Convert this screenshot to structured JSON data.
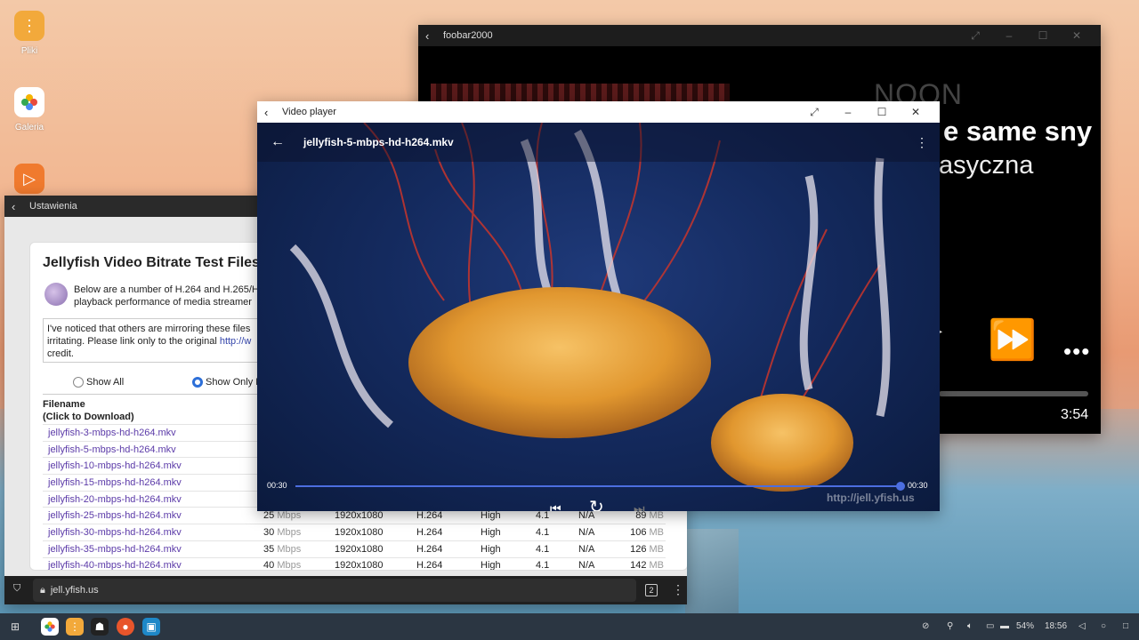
{
  "desktop": {
    "icons": [
      {
        "label": "Pliki",
        "icon": "files-icon",
        "color": "#f2a93b"
      },
      {
        "label": "Galeria",
        "icon": "gallery-icon",
        "color": "#ffffff"
      },
      {
        "label": "",
        "icon": "video-player-icon",
        "color": "#f07a2e"
      }
    ]
  },
  "foobar": {
    "title": "foobar2000",
    "artist_partial": "NOON",
    "song_partial": "e same sny",
    "genre_partial": "asyczna",
    "duration": "3:54"
  },
  "settings": {
    "title": "Ustawienia",
    "page_heading": "Jellyfish Video Bitrate Test Files",
    "intro_text": "Below are a number of H.264 and H.265/H playback performance of media streamer",
    "notice_text": "I've noticed that others are mirroring these files irritating. Please link only to the original ",
    "notice_link": "http://w",
    "notice_end": "credit.",
    "radio_all": "Show All",
    "radio_only": "Show Only H",
    "header_filename": "Filename",
    "header_click": "(Click to Download)",
    "rows": [
      {
        "file": "jellyfish-3-mbps-hd-h264.mkv",
        "bitrate": "",
        "unit": "",
        "res": "",
        "codec": "",
        "profile": "",
        "level": "",
        "na": "",
        "size": "",
        "sunit": ""
      },
      {
        "file": "jellyfish-5-mbps-hd-h264.mkv",
        "bitrate": "",
        "unit": "",
        "res": "",
        "codec": "",
        "profile": "",
        "level": "",
        "na": "",
        "size": "",
        "sunit": ""
      },
      {
        "file": "jellyfish-10-mbps-hd-h264.mkv",
        "bitrate": "",
        "unit": "",
        "res": "",
        "codec": "",
        "profile": "",
        "level": "",
        "na": "",
        "size": "",
        "sunit": ""
      },
      {
        "file": "jellyfish-15-mbps-hd-h264.mkv",
        "bitrate": "",
        "unit": "",
        "res": "",
        "codec": "",
        "profile": "",
        "level": "",
        "na": "",
        "size": "",
        "sunit": ""
      },
      {
        "file": "jellyfish-20-mbps-hd-h264.mkv",
        "bitrate": "",
        "unit": "",
        "res": "",
        "codec": "",
        "profile": "",
        "level": "",
        "na": "",
        "size": "",
        "sunit": ""
      },
      {
        "file": "jellyfish-25-mbps-hd-h264.mkv",
        "bitrate": "25",
        "unit": "Mbps",
        "res": "1920x1080",
        "codec": "H.264",
        "profile": "High",
        "level": "4.1",
        "na": "N/A",
        "size": "89",
        "sunit": "MB"
      },
      {
        "file": "jellyfish-30-mbps-hd-h264.mkv",
        "bitrate": "30",
        "unit": "Mbps",
        "res": "1920x1080",
        "codec": "H.264",
        "profile": "High",
        "level": "4.1",
        "na": "N/A",
        "size": "106",
        "sunit": "MB"
      },
      {
        "file": "jellyfish-35-mbps-hd-h264.mkv",
        "bitrate": "35",
        "unit": "Mbps",
        "res": "1920x1080",
        "codec": "H.264",
        "profile": "High",
        "level": "4.1",
        "na": "N/A",
        "size": "126",
        "sunit": "MB"
      },
      {
        "file": "jellyfish-40-mbps-hd-h264.mkv",
        "bitrate": "40",
        "unit": "Mbps",
        "res": "1920x1080",
        "codec": "H.264",
        "profile": "High",
        "level": "4.1",
        "na": "N/A",
        "size": "142",
        "sunit": "MB"
      }
    ],
    "url": "jell.yfish.us",
    "tab_count": "2"
  },
  "video_player": {
    "title": "Video player",
    "filename": "jellyfish-5-mbps-hd-h264.mkv",
    "time_current": "00:30",
    "time_total": "00:30",
    "progress_fraction": 1.0,
    "watermark": "http://jell.yfish.us",
    "accent_color": "#4c6ee0"
  },
  "taskbar": {
    "apps": [
      "gallery-icon",
      "files-icon",
      "cat-icon",
      "firefox-icon",
      "store-icon"
    ],
    "battery": "54%",
    "clock": "18:56"
  }
}
